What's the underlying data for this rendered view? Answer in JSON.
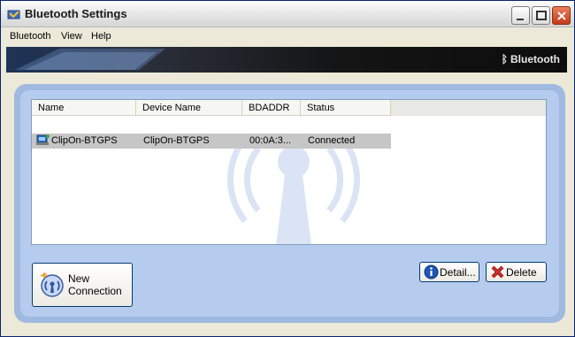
{
  "window": {
    "title": "Bluetooth Settings"
  },
  "menu": {
    "items": [
      "Bluetooth",
      "View",
      "Help"
    ]
  },
  "banner": {
    "logo_text": "Bluetooth"
  },
  "list": {
    "columns": [
      "Name",
      "Device Name",
      "BDADDR",
      "Status"
    ],
    "rows": [
      {
        "name": "ClipOn-BTGPS",
        "device_name": "ClipOn-BTGPS",
        "bdaddr": "00:0A:3...",
        "status": "Connected",
        "icon": "device-icon"
      }
    ]
  },
  "buttons": {
    "new_connection_line1": "New",
    "new_connection_line2": "Connection",
    "detail": "Detail...",
    "delete": "Delete"
  },
  "colors": {
    "panel": "#b6ccef",
    "panel_border": "#9fb9e0",
    "selected_row": "#c6c6c6",
    "banner": "#141414",
    "close_button": "#c43b17"
  }
}
